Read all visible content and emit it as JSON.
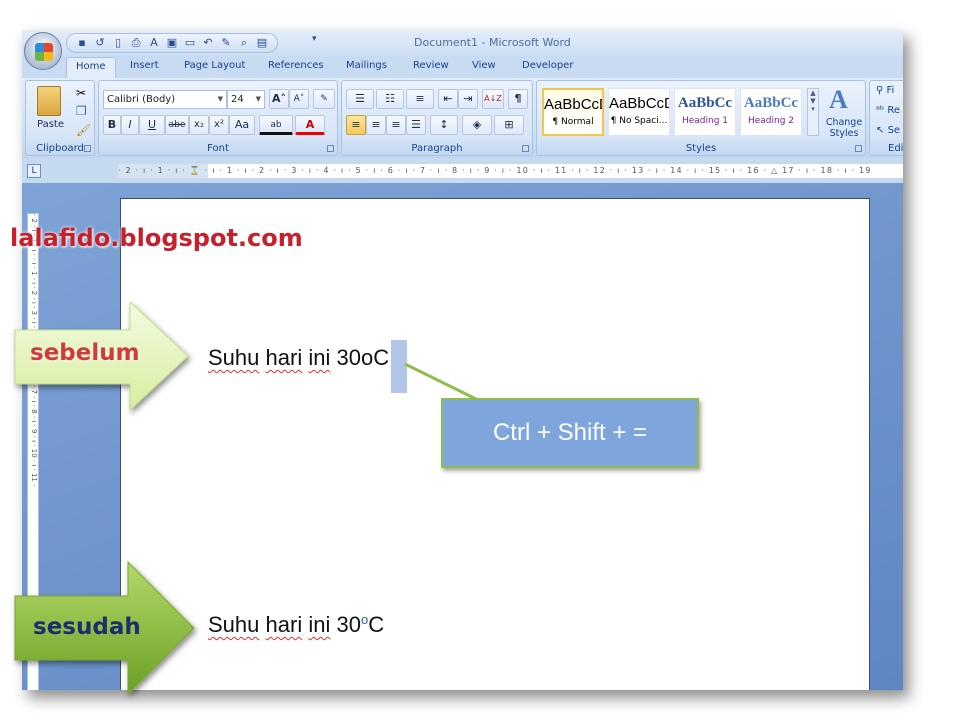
{
  "window": {
    "title": "Document1 - Microsoft Word"
  },
  "quick_access": [
    "save-icon",
    "redo-icon",
    "new-icon",
    "print-icon",
    "font-icon",
    "paste-special-icon",
    "document-icon",
    "undo-icon",
    "edit-icon",
    "print-preview-icon",
    "open-icon",
    "customize-icon"
  ],
  "tabs": [
    {
      "label": "Home",
      "active": true
    },
    {
      "label": "Insert"
    },
    {
      "label": "Page Layout"
    },
    {
      "label": "References"
    },
    {
      "label": "Mailings"
    },
    {
      "label": "Review"
    },
    {
      "label": "View"
    },
    {
      "label": "Developer"
    }
  ],
  "ribbon": {
    "clipboard": {
      "label": "Clipboard",
      "paste": "Paste"
    },
    "font": {
      "label": "Font",
      "font_name": "Calibri (Body)",
      "font_size": "24",
      "bold": "B",
      "italic": "I",
      "underline": "U",
      "strike": "abe",
      "subscript": "x₂",
      "superscript": "x²",
      "change_case": "Aa",
      "grow": "A˄",
      "shrink": "A˅",
      "font_color": "A",
      "highlight": "ab"
    },
    "paragraph": {
      "label": "Paragraph",
      "show_marks": "¶",
      "sort": "A↓Z"
    },
    "styles": {
      "label": "Styles",
      "items": [
        {
          "sample": "AaBbCcDc",
          "name": "¶ Normal",
          "selected": true
        },
        {
          "sample": "AaBbCcDc",
          "name": "¶ No Spaci..."
        },
        {
          "sample": "AaBbCc",
          "name": "Heading 1"
        },
        {
          "sample": "AaBbCc",
          "name": "Heading 2"
        }
      ],
      "change_styles": "Change Styles"
    },
    "editing": {
      "label": "Edi",
      "find": "Fi",
      "replace": "Re",
      "select": "Se"
    }
  },
  "ruler": {
    "horizontal": "· 2 · ı · 1 · ı · ⌛ · ı · 1 · ı · 2 · ı · 3 · ı · 4 · ı · 5 · ı · 6 · ı · 7 · ı · 8 · ı · 9 · ı · 10 · ı · 11 · ı · 12 · ı · 13 · ı · 14 · ı · 15 · ı · 16 · △ 17 · ı · 18 · ı · 19",
    "vertical": "· 2 · ı · 1 · ı · · ı · 1 · ı · 2 · ı · 3 · ı · 4 · ı · 5 · ı · 6 · ı · 7 · ı · 8 · ı · 9 · ı · 10 · ı · 11 ·",
    "tab_selector": "L"
  },
  "document": {
    "before": {
      "words": [
        "Suhu",
        "hari",
        "ini"
      ],
      "number": "30",
      "degree": "o",
      "unit": "C"
    },
    "after": {
      "words": [
        "Suhu",
        "hari",
        "ini"
      ],
      "number": "30",
      "degree": "o",
      "unit": "C"
    }
  },
  "annotations": {
    "watermark": "lalafido.blogspot.com",
    "before_label": "sebelum",
    "after_label": "sesudah",
    "shortcut": "Ctrl + Shift + =",
    "colors": {
      "before_arrow": "#e7f6c0",
      "after_arrow": "#8fc13a",
      "callout": "#7ea6dc",
      "callout_border": "#8fbd4c",
      "watermark": "#c8202a",
      "before_text": "#d23a3a",
      "after_text": "#1a2f6e"
    }
  }
}
